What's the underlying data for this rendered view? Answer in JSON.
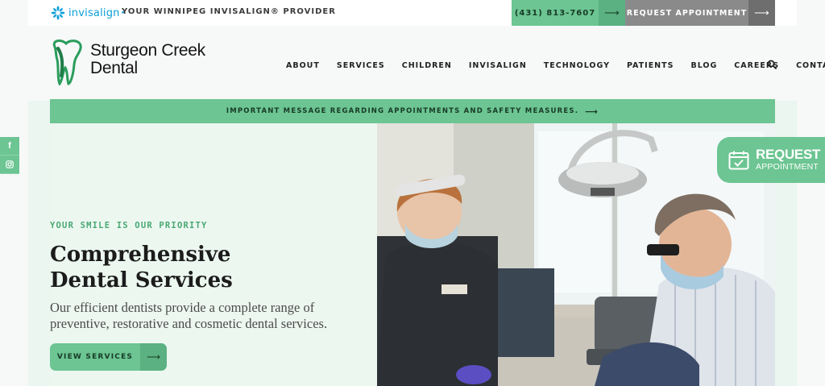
{
  "topbar": {
    "invisalign_logo_text": "invisalign",
    "provider_text": "YOUR WINNIPEG INVISALIGN® PROVIDER",
    "phone_label": "(431) 813-7607",
    "request_label": "REQUEST APPOINTMENT",
    "arrow_icon": "arrow-right-icon"
  },
  "header": {
    "logo_line1": "Sturgeon Creek",
    "logo_line2": "Dental",
    "nav": [
      "ABOUT",
      "SERVICES",
      "CHILDREN",
      "INVISALIGN",
      "TECHNOLOGY",
      "PATIENTS",
      "BLOG",
      "CAREERS",
      "CONTACT"
    ]
  },
  "message_bar": {
    "text": "IMPORTANT MESSAGE REGARDING APPOINTMENTS AND SAFETY MEASURES."
  },
  "hero": {
    "eyebrow": "YOUR SMILE IS OUR PRIORITY",
    "headline": "Comprehensive Dental Services",
    "description": "Our efficient dentists provide a complete range of preventive, restorative and cosmetic dental services.",
    "button_label": "VIEW SERVICES"
  },
  "social": {
    "facebook": "f",
    "instagram_icon": "instagram-icon"
  },
  "floating_request": {
    "line1": "REQUEST",
    "line2": "APPOINTMENT"
  },
  "colors": {
    "accent_green": "#6cc592",
    "accent_green_dark": "#5bb182",
    "gray_button": "#8a8a8a",
    "invisalign_blue": "#0c9fd8",
    "hero_bg": "#ecf7f0"
  }
}
